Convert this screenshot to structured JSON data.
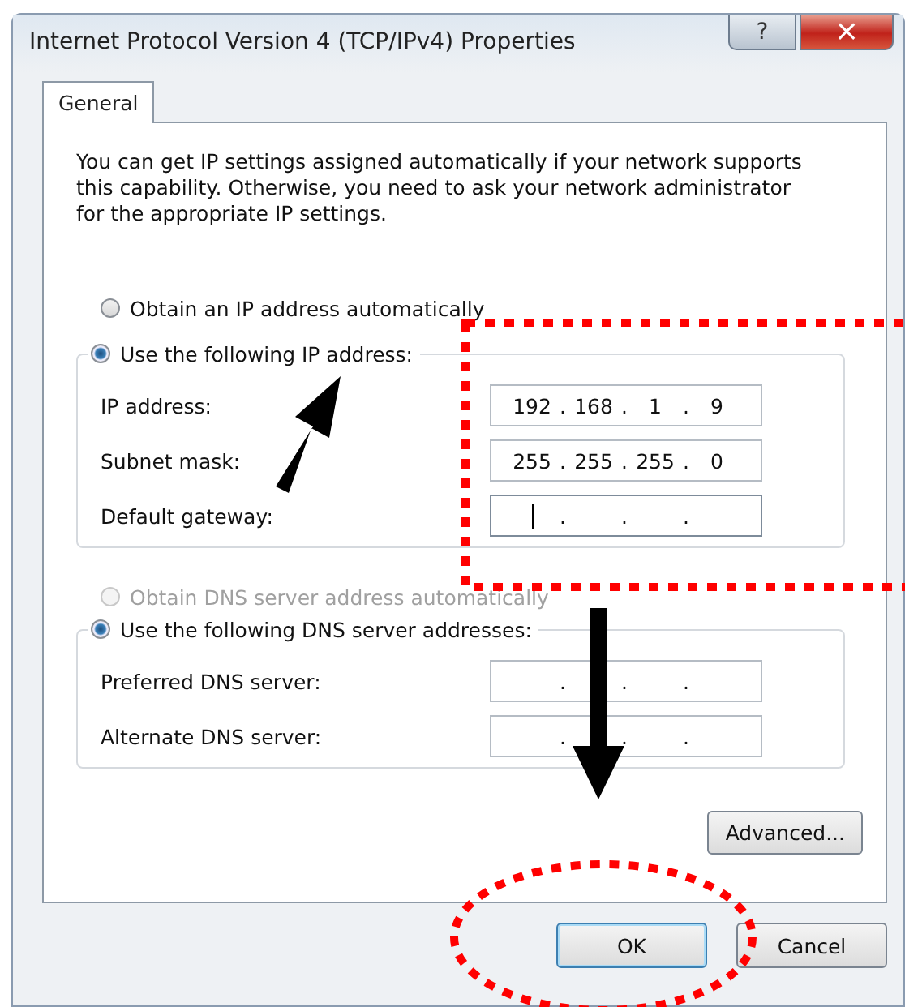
{
  "window": {
    "title": "Internet Protocol Version 4 (TCP/IPv4) Properties",
    "help": "?",
    "close": "×"
  },
  "tabs": [
    {
      "label": "General",
      "selected": true
    }
  ],
  "description": "You can get IP settings assigned automatically if your network supports this capability. Otherwise, you need to ask your network administrator for the appropriate IP settings.",
  "ip_options": [
    {
      "label": "Obtain an IP address automatically",
      "selected": false,
      "disabled": false
    },
    {
      "label": "Use the following IP address:",
      "selected": true,
      "disabled": false
    }
  ],
  "ip_fields": [
    {
      "label": "IP address:",
      "octets": [
        "192",
        "168",
        "1",
        "9"
      ],
      "separators": [
        ".",
        ".",
        "."
      ],
      "focused": false
    },
    {
      "label": "Subnet mask:",
      "octets": [
        "255",
        "255",
        "255",
        "0"
      ],
      "separators": [
        ".",
        ".",
        "."
      ],
      "focused": false
    },
    {
      "label": "Default gateway:",
      "separators": [
        ".",
        ".",
        "."
      ],
      "focused": true
    }
  ],
  "dns_options": [
    {
      "label": "Obtain DNS server address automatically",
      "selected": false,
      "disabled": true
    },
    {
      "label": "Use the following DNS server addresses:",
      "selected": true,
      "disabled": false
    }
  ],
  "dns_fields": [
    {
      "label": "Preferred DNS server:",
      "separators": [
        ".",
        ".",
        "."
      ],
      "focused": false
    },
    {
      "label": "Alternate DNS server:",
      "separators": [
        ".",
        ".",
        "."
      ],
      "focused": false
    }
  ],
  "advanced_button": "Advanced...",
  "buttons": [
    {
      "label": "OK",
      "default": true
    },
    {
      "label": "Cancel",
      "default": false
    }
  ]
}
